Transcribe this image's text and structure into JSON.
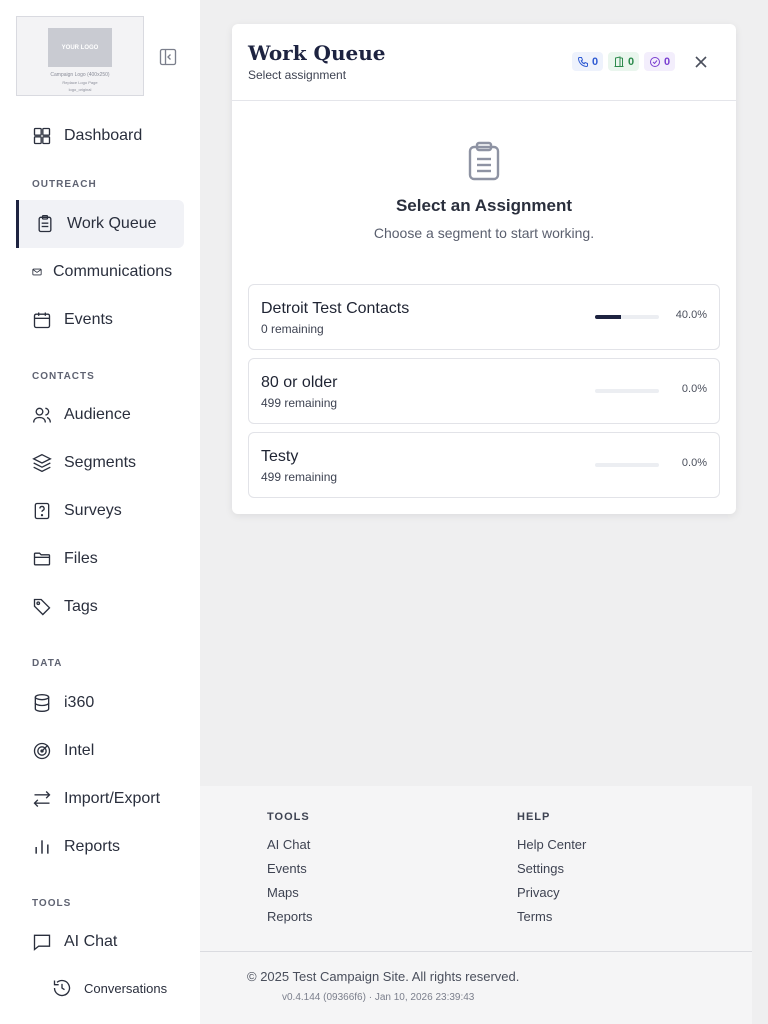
{
  "logo": {
    "text": "YOUR LOGO",
    "line1": "Campaign Logo (400x250)",
    "line2": "Replace Logo Page",
    "line3": "logo_original"
  },
  "sidebar": {
    "top_items": [
      {
        "label": "Dashboard",
        "icon": "dashboard-icon"
      }
    ],
    "sections": [
      {
        "label": "OUTREACH",
        "items": [
          {
            "label": "Work Queue",
            "icon": "clipboard-icon",
            "active": true
          },
          {
            "label": "Communications",
            "icon": "mail-icon"
          },
          {
            "label": "Events",
            "icon": "calendar-icon"
          }
        ]
      },
      {
        "label": "CONTACTS",
        "items": [
          {
            "label": "Audience",
            "icon": "users-icon"
          },
          {
            "label": "Segments",
            "icon": "layers-icon"
          },
          {
            "label": "Surveys",
            "icon": "survey-icon"
          },
          {
            "label": "Files",
            "icon": "folder-icon"
          },
          {
            "label": "Tags",
            "icon": "tag-icon"
          }
        ]
      },
      {
        "label": "DATA",
        "items": [
          {
            "label": "i360",
            "icon": "database-icon"
          },
          {
            "label": "Intel",
            "icon": "radar-icon"
          },
          {
            "label": "Import/Export",
            "icon": "arrows-icon"
          },
          {
            "label": "Reports",
            "icon": "chart-icon"
          }
        ]
      },
      {
        "label": "TOOLS",
        "items": [
          {
            "label": "AI Chat",
            "icon": "chat-icon"
          },
          {
            "label": "Conversations",
            "icon": "history-icon"
          }
        ]
      }
    ]
  },
  "work_queue": {
    "title": "Work Queue",
    "subtitle": "Select assignment",
    "stats": {
      "calls": "0",
      "doors": "0",
      "completed": "0"
    },
    "empty_title": "Select an Assignment",
    "empty_subtitle": "Choose a segment to start working.",
    "segments": [
      {
        "name": "Detroit Test Contacts",
        "remaining": "0 remaining",
        "progress": 0.4,
        "percent": "40.0%"
      },
      {
        "name": "80 or older",
        "remaining": "499 remaining",
        "progress": 0.0,
        "percent": "0.0%"
      },
      {
        "name": "Testy",
        "remaining": "499 remaining",
        "progress": 0.0,
        "percent": "0.0%"
      }
    ]
  },
  "footer": {
    "tools_heading": "TOOLS",
    "tools_links": [
      "AI Chat",
      "Events",
      "Maps",
      "Reports"
    ],
    "help_heading": "HELP",
    "help_links": [
      "Help Center",
      "Settings",
      "Privacy",
      "Terms"
    ],
    "copyright": "© 2025 Test Campaign Site. All rights reserved.",
    "version": "v0.4.144 (09366f6) · Jan 10, 2026 23:39:43"
  },
  "colors": {
    "accent": "#1d2340",
    "call_badge_bg": "#eef2fc",
    "call_badge_fg": "#2f5bd3",
    "door_badge_bg": "#eaf6ee",
    "door_badge_fg": "#2c8a4c",
    "done_badge_bg": "#f3eefc",
    "done_badge_fg": "#7a3fd1"
  }
}
